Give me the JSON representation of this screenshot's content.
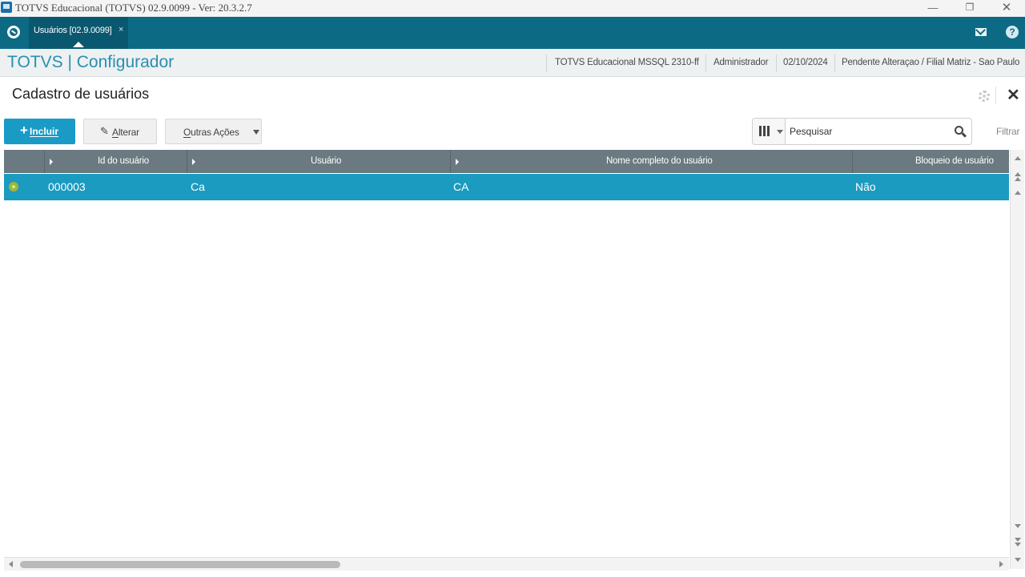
{
  "window": {
    "title": "TOTVS Educacional (TOTVS) 02.9.0099 - Ver: 20.3.2.7",
    "minimize": "—",
    "maximize": "❐",
    "close": "✕"
  },
  "tabbar": {
    "active_tab": "Usuários [02.9.0099]",
    "tab_close": "×",
    "help": "?"
  },
  "header": {
    "brand": "TOTVS | Configurador",
    "environment": "TOTVS Educacional MSSQL 2310-ff",
    "user": "Administrador",
    "date": "02/10/2024",
    "branch": "Pendente Alteraçao / Filial Matriz - Sao Paulo"
  },
  "page": {
    "title": "Cadastro de usuários",
    "close": "✕"
  },
  "toolbar": {
    "incluir_plus": "+",
    "incluir_first": "I",
    "incluir_rest": "ncluir",
    "alterar_icon": "✎",
    "alterar_first": "A",
    "alterar_rest": "lterar",
    "outras_first": "O",
    "outras_rest": "utras Ações"
  },
  "search": {
    "placeholder": "Pesquisar",
    "filter_label": "Filtrar"
  },
  "grid": {
    "columns": [
      {
        "label": "Id do usuário"
      },
      {
        "label": "Usuário"
      },
      {
        "label": "Nome completo do usuário"
      },
      {
        "label": "Bloqueio de usuário"
      }
    ],
    "rows": [
      {
        "id": "000003",
        "usuario": "Ca",
        "nome": "CA",
        "bloqueio": "Não"
      }
    ]
  },
  "colors": {
    "teal_bar": "#0d6a84",
    "accent": "#1a9bc6",
    "brand_text": "#2a8fb0",
    "grid_header": "#6a7a80",
    "selected_row": "#1a9bbf"
  },
  "icons": [
    "app-icon",
    "home-icon",
    "mail-icon",
    "help-icon",
    "gear-icon",
    "close-icon",
    "plus-icon",
    "pencil-icon",
    "chevron-down-icon",
    "columns-icon",
    "search-icon",
    "legend-status-icon"
  ]
}
